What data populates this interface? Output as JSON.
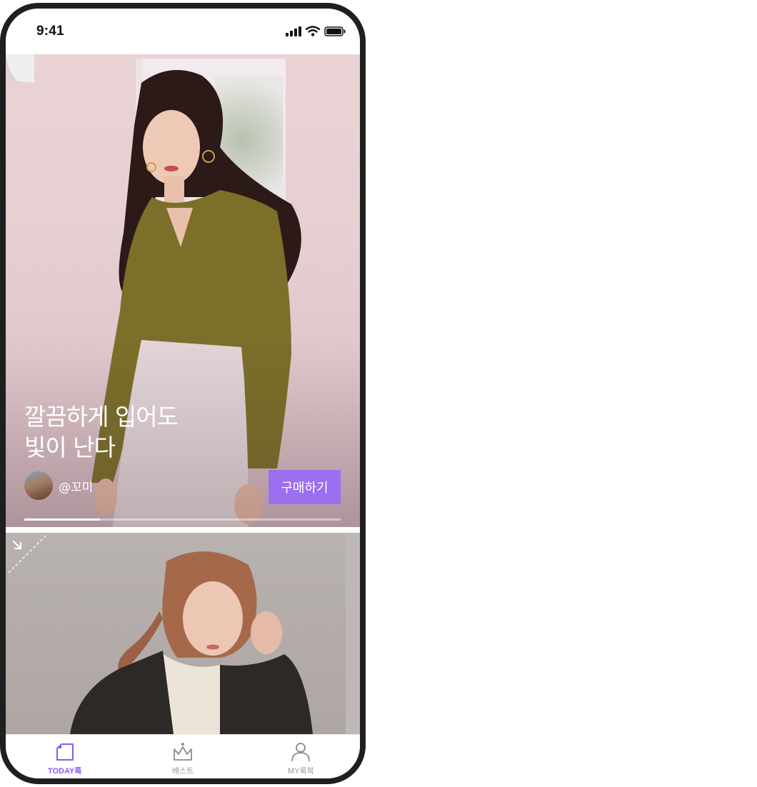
{
  "status_bar": {
    "time": "9:41"
  },
  "feed": {
    "card1": {
      "title_line1": "깔끔하게 입어도",
      "title_line2": "빛이 난다",
      "author": "@꼬미",
      "buy_label": "구매하기",
      "progress": 0.24
    }
  },
  "tab_bar": {
    "tabs": [
      {
        "label": "TODAY룩",
        "icon": "page-icon",
        "active": true
      },
      {
        "label": "베스트",
        "icon": "crown-icon",
        "active": false
      },
      {
        "label": "MY룩북",
        "icon": "person-icon",
        "active": false
      }
    ]
  },
  "colors": {
    "accent": "#9b6ff0",
    "tab_active": "#8b5cf6",
    "tab_inactive": "#9a9a9a"
  }
}
